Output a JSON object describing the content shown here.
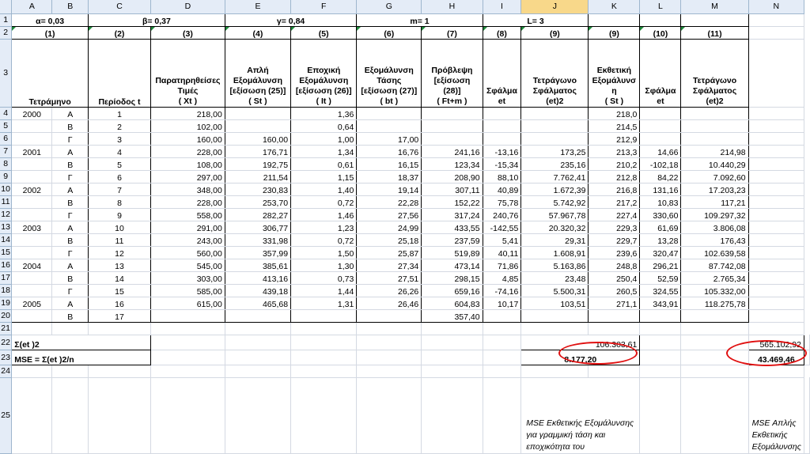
{
  "columns": [
    "A",
    "B",
    "C",
    "D",
    "E",
    "F",
    "G",
    "H",
    "I",
    "J",
    "K",
    "L",
    "M",
    "N"
  ],
  "row_numbers": [
    "1",
    "2",
    "3",
    "4",
    "5",
    "6",
    "7",
    "8",
    "9",
    "10",
    "11",
    "12",
    "13",
    "14",
    "15",
    "16",
    "17",
    "18",
    "19",
    "20",
    "21",
    "22",
    "23",
    "24",
    "25"
  ],
  "row1": {
    "alpha": "α= 0,03",
    "beta": "β= 0,37",
    "gamma": "γ= 0,84",
    "m": "m= 1",
    "L": "L= 3"
  },
  "row2": [
    "(1)",
    "(2)",
    "(3)",
    "(4)",
    "(5)",
    "(6)",
    "(7)",
    "(8)",
    "(9)",
    "(9)",
    "(10)",
    "(11)"
  ],
  "header3": {
    "quarter": "Τετράμηνο",
    "period": "Περίοδος t",
    "observed": [
      "Παρατηρηθείσες",
      "Τιμές",
      "( Xt )"
    ],
    "simple": [
      "Απλή",
      "Εξομάλυνση",
      "[εξίσωση (25)]",
      "( St )"
    ],
    "seasonal": [
      "Εποχική",
      "Εξομάλυνση",
      "[εξίσωση (26)]",
      "( It )"
    ],
    "trend": [
      "Εξομάλυνση",
      "Τάσης",
      "[εξίσωση (27)]",
      "( bt )"
    ],
    "forecast": [
      "Πρόβλεψη",
      "[εξίσωση (28)]",
      "( Ft+m )"
    ],
    "error1": [
      "Σφάλμα",
      "et"
    ],
    "sqerror1": [
      "Τετράγωνο",
      "Σφάλματος",
      "(et)2"
    ],
    "exp": [
      "Εκθετική",
      "Εξομάλυνσ",
      "η",
      "( St )"
    ],
    "error2": [
      "Σφάλμα",
      "et"
    ],
    "sqerror2": [
      "Τετράγωνο",
      "Σφάλματος",
      "(et)2"
    ]
  },
  "rows": [
    {
      "y": "2000",
      "q": "Α",
      "t": "1",
      "x": "218,00",
      "s": "",
      "i": "1,36",
      "b": "",
      "f": "",
      "e": "",
      "e2": "",
      "k": "218,0",
      "l": "",
      "m": ""
    },
    {
      "y": "",
      "q": "Β",
      "t": "2",
      "x": "102,00",
      "s": "",
      "i": "0,64",
      "b": "",
      "f": "",
      "e": "",
      "e2": "",
      "k": "214,5",
      "l": "",
      "m": ""
    },
    {
      "y": "",
      "q": "Γ",
      "t": "3",
      "x": "160,00",
      "s": "160,00",
      "i": "1,00",
      "b": "17,00",
      "f": "",
      "e": "",
      "e2": "",
      "k": "212,9",
      "l": "",
      "m": ""
    },
    {
      "y": "2001",
      "q": "Α",
      "t": "4",
      "x": "228,00",
      "s": "176,71",
      "i": "1,34",
      "b": "16,76",
      "f": "241,16",
      "e": "-13,16",
      "e2": "173,25",
      "k": "213,3",
      "l": "14,66",
      "m": "214,98"
    },
    {
      "y": "",
      "q": "Β",
      "t": "5",
      "x": "108,00",
      "s": "192,75",
      "i": "0,61",
      "b": "16,15",
      "f": "123,34",
      "e": "-15,34",
      "e2": "235,16",
      "k": "210,2",
      "l": "-102,18",
      "m": "10.440,29"
    },
    {
      "y": "",
      "q": "Γ",
      "t": "6",
      "x": "297,00",
      "s": "211,54",
      "i": "1,15",
      "b": "18,37",
      "f": "208,90",
      "e": "88,10",
      "e2": "7.762,41",
      "k": "212,8",
      "l": "84,22",
      "m": "7.092,60"
    },
    {
      "y": "2002",
      "q": "Α",
      "t": "7",
      "x": "348,00",
      "s": "230,83",
      "i": "1,40",
      "b": "19,14",
      "f": "307,11",
      "e": "40,89",
      "e2": "1.672,39",
      "k": "216,8",
      "l": "131,16",
      "m": "17.203,23"
    },
    {
      "y": "",
      "q": "Β",
      "t": "8",
      "x": "228,00",
      "s": "253,70",
      "i": "0,72",
      "b": "22,28",
      "f": "152,22",
      "e": "75,78",
      "e2": "5.742,92",
      "k": "217,2",
      "l": "10,83",
      "m": "117,21"
    },
    {
      "y": "",
      "q": "Γ",
      "t": "9",
      "x": "558,00",
      "s": "282,27",
      "i": "1,46",
      "b": "27,56",
      "f": "317,24",
      "e": "240,76",
      "e2": "57.967,78",
      "k": "227,4",
      "l": "330,60",
      "m": "109.297,32"
    },
    {
      "y": "2003",
      "q": "Α",
      "t": "10",
      "x": "291,00",
      "s": "306,77",
      "i": "1,23",
      "b": "24,99",
      "f": "433,55",
      "e": "-142,55",
      "e2": "20.320,32",
      "k": "229,3",
      "l": "61,69",
      "m": "3.806,08"
    },
    {
      "y": "",
      "q": "Β",
      "t": "11",
      "x": "243,00",
      "s": "331,98",
      "i": "0,72",
      "b": "25,18",
      "f": "237,59",
      "e": "5,41",
      "e2": "29,31",
      "k": "229,7",
      "l": "13,28",
      "m": "176,43"
    },
    {
      "y": "",
      "q": "Γ",
      "t": "12",
      "x": "560,00",
      "s": "357,99",
      "i": "1,50",
      "b": "25,87",
      "f": "519,89",
      "e": "40,11",
      "e2": "1.608,91",
      "k": "239,6",
      "l": "320,47",
      "m": "102.639,58"
    },
    {
      "y": "2004",
      "q": "Α",
      "t": "13",
      "x": "545,00",
      "s": "385,61",
      "i": "1,30",
      "b": "27,34",
      "f": "473,14",
      "e": "71,86",
      "e2": "5.163,86",
      "k": "248,8",
      "l": "296,21",
      "m": "87.742,08"
    },
    {
      "y": "",
      "q": "Β",
      "t": "14",
      "x": "303,00",
      "s": "413,16",
      "i": "0,73",
      "b": "27,51",
      "f": "298,15",
      "e": "4,85",
      "e2": "23,48",
      "k": "250,4",
      "l": "52,59",
      "m": "2.765,34"
    },
    {
      "y": "",
      "q": "Γ",
      "t": "15",
      "x": "585,00",
      "s": "439,18",
      "i": "1,44",
      "b": "26,26",
      "f": "659,16",
      "e": "-74,16",
      "e2": "5.500,31",
      "k": "260,5",
      "l": "324,55",
      "m": "105.332,00"
    },
    {
      "y": "2005",
      "q": "Α",
      "t": "16",
      "x": "615,00",
      "s": "465,68",
      "i": "1,31",
      "b": "26,46",
      "f": "604,83",
      "e": "10,17",
      "e2": "103,51",
      "k": "271,1",
      "l": "343,91",
      "m": "118.275,78"
    },
    {
      "y": "",
      "q": "Β",
      "t": "17",
      "x": "",
      "s": "",
      "i": "",
      "b": "",
      "f": "357,40",
      "e": "",
      "e2": "",
      "k": "",
      "l": "",
      "m": ""
    }
  ],
  "sum_label": "Σ(et )2",
  "mse_label": "MSE = Σ(et )2/n",
  "sum_j": "106.303,61",
  "mse_j": "8.177,20",
  "sum_m": "565.102,92",
  "mse_m": "43.469,46",
  "note_j": "MSE Εκθετικής Εξομάλυνσης για γραμμική τάση και εποχικότητα του",
  "note_m": "MSE Απλής Εκθετικής Εξομάλυνσης"
}
